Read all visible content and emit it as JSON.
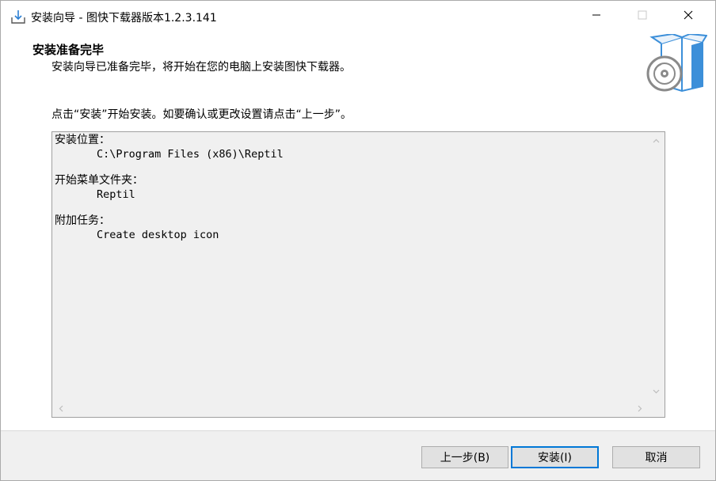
{
  "window": {
    "title": "安装向导 - 图快下载器版本1.2.3.141",
    "icon": "download-icon",
    "controls": {
      "minimize": "minimize-icon",
      "maximize": "maximize-icon",
      "close": "close-icon"
    }
  },
  "header": {
    "title": "安装准备完毕",
    "subtitle": "安装向导已准备完毕，将开始在您的电脑上安装图快下载器。",
    "logo": "install-box-cd-icon"
  },
  "instruction": "点击“安装”开始安装。如要确认或更改设置请点击“上一步”。",
  "summary": {
    "sections": [
      {
        "label": "安装位置：",
        "value": "C:\\Program Files (x86)\\Reptil"
      },
      {
        "label": "开始菜单文件夹：",
        "value": "Reptil"
      },
      {
        "label": "附加任务：",
        "value": "Create desktop icon"
      }
    ]
  },
  "buttons": {
    "back": "上一步(B)",
    "install": "安装(I)",
    "cancel": "取消"
  },
  "colors": {
    "accent": "#0078d7",
    "logo_blue": "#3c8fd9",
    "footer_bg": "#f0f0f0"
  }
}
